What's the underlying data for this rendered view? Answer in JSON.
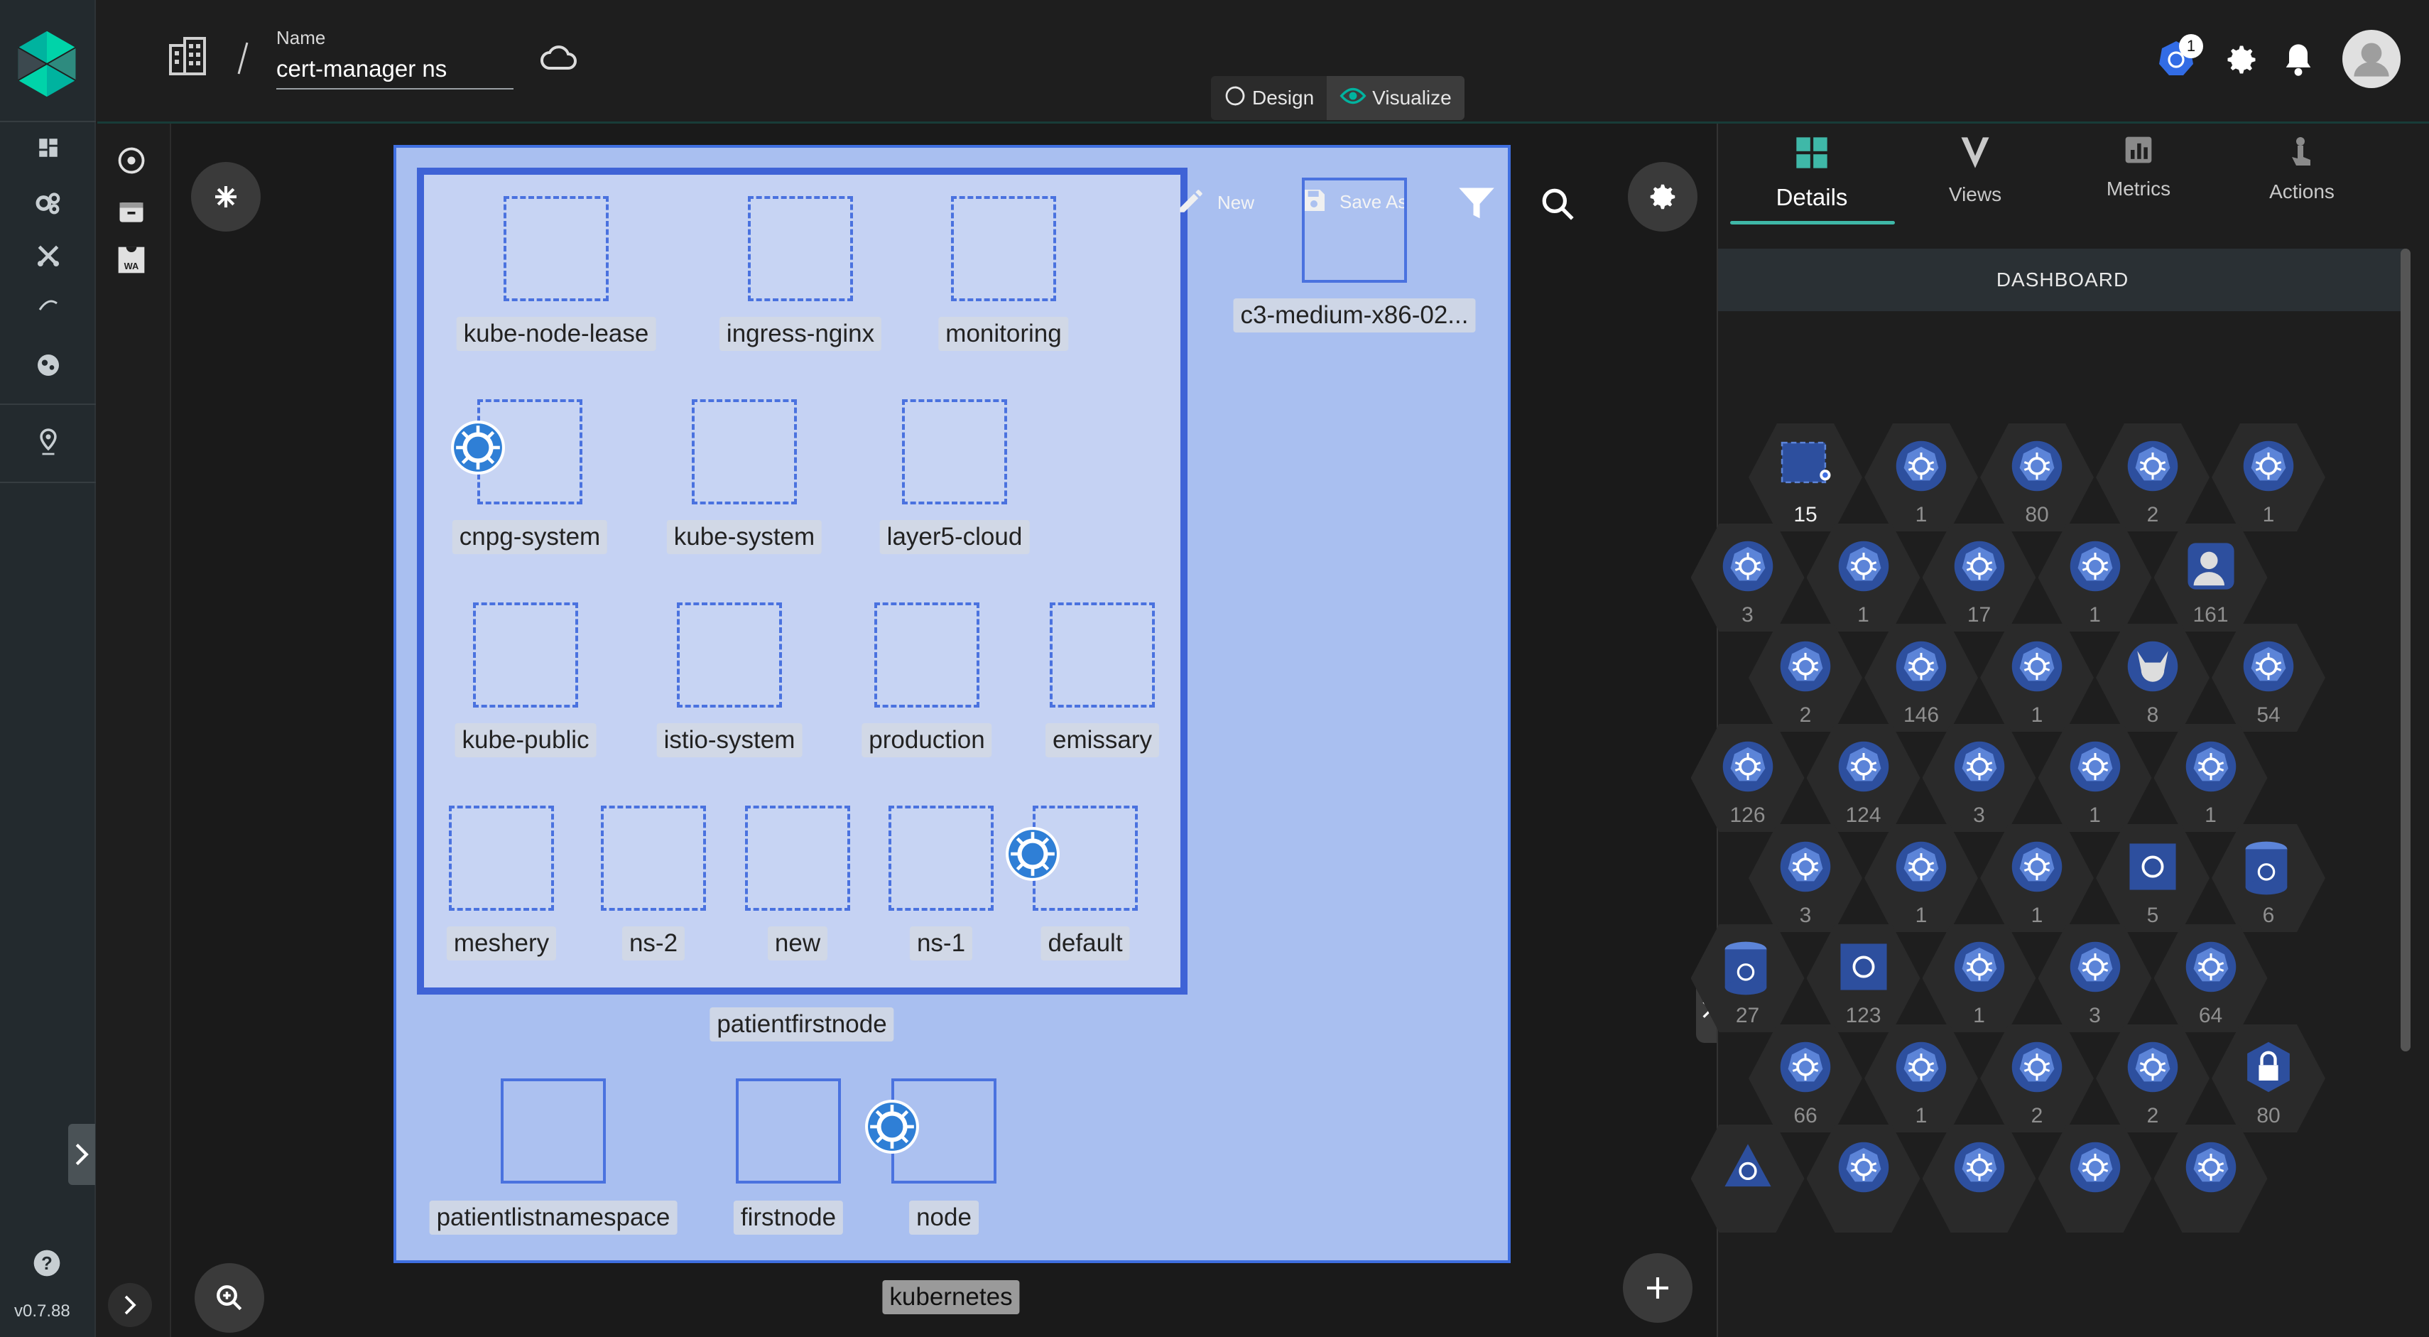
{
  "app": {
    "version": "v0.7.88",
    "colors": {
      "brand": "#00b39f",
      "accent": "#3f63d6",
      "canvas_bg": "#a9bff0",
      "panel_bg": "#1e1e1e"
    }
  },
  "sidebar": {
    "items": [
      {
        "icon": "dashboard-icon"
      },
      {
        "icon": "settings-cluster-icon"
      },
      {
        "icon": "tools-icon"
      },
      {
        "icon": "signal-icon"
      },
      {
        "icon": "cloud-native-icon"
      },
      {
        "icon": "location-pin-icon"
      }
    ],
    "help_icon": "help-icon"
  },
  "header": {
    "name_label": "Name",
    "name_value": "cert-manager ns",
    "modes": [
      {
        "label": "Design",
        "icon": "design-icon"
      },
      {
        "label": "Visualize",
        "icon": "eye-icon",
        "active": true
      }
    ],
    "notification_badge": "1"
  },
  "canvas": {
    "toolbar": {
      "new_label": "New",
      "save_as_label": "Save As"
    },
    "cluster_label": "kubernetes",
    "node_label": "patientfirstnode",
    "external_node_label": "c3-medium-x86-02...",
    "namespaces": [
      {
        "name": "kube-node-lease"
      },
      {
        "name": "ingress-nginx"
      },
      {
        "name": "monitoring"
      },
      {
        "name": "cnpg-system"
      },
      {
        "name": "kube-system"
      },
      {
        "name": "layer5-cloud"
      },
      {
        "name": "kube-public"
      },
      {
        "name": "istio-system"
      },
      {
        "name": "production"
      },
      {
        "name": "emissary"
      },
      {
        "name": "meshery"
      },
      {
        "name": "ns-2"
      },
      {
        "name": "new"
      },
      {
        "name": "ns-1"
      },
      {
        "name": "default"
      }
    ],
    "outside_nodes": [
      {
        "name": "patientlistnamespace"
      },
      {
        "name": "firstnode"
      },
      {
        "name": "node"
      }
    ]
  },
  "right_panel": {
    "tabs": [
      {
        "label": "Details",
        "icon": "grid-icon",
        "active": true
      },
      {
        "label": "Views",
        "icon": "views-icon"
      },
      {
        "label": "Metrics",
        "icon": "metrics-icon"
      },
      {
        "label": "Actions",
        "icon": "actions-icon"
      }
    ],
    "dashboard_label": "DASHBOARD",
    "hex_rows": [
      [
        "15",
        "1",
        "80",
        "2",
        "1"
      ],
      [
        "3",
        "1",
        "17",
        "1",
        "161"
      ],
      [
        "2",
        "146",
        "1",
        "8",
        "54"
      ],
      [
        "126",
        "124",
        "3",
        "1",
        "1"
      ],
      [
        "3",
        "1",
        "1",
        "5",
        "6"
      ],
      [
        "27",
        "123",
        "1",
        "3",
        "64"
      ],
      [
        "66",
        "1",
        "2",
        "2",
        "80"
      ],
      [
        "",
        "",
        "",
        "",
        ""
      ]
    ]
  }
}
